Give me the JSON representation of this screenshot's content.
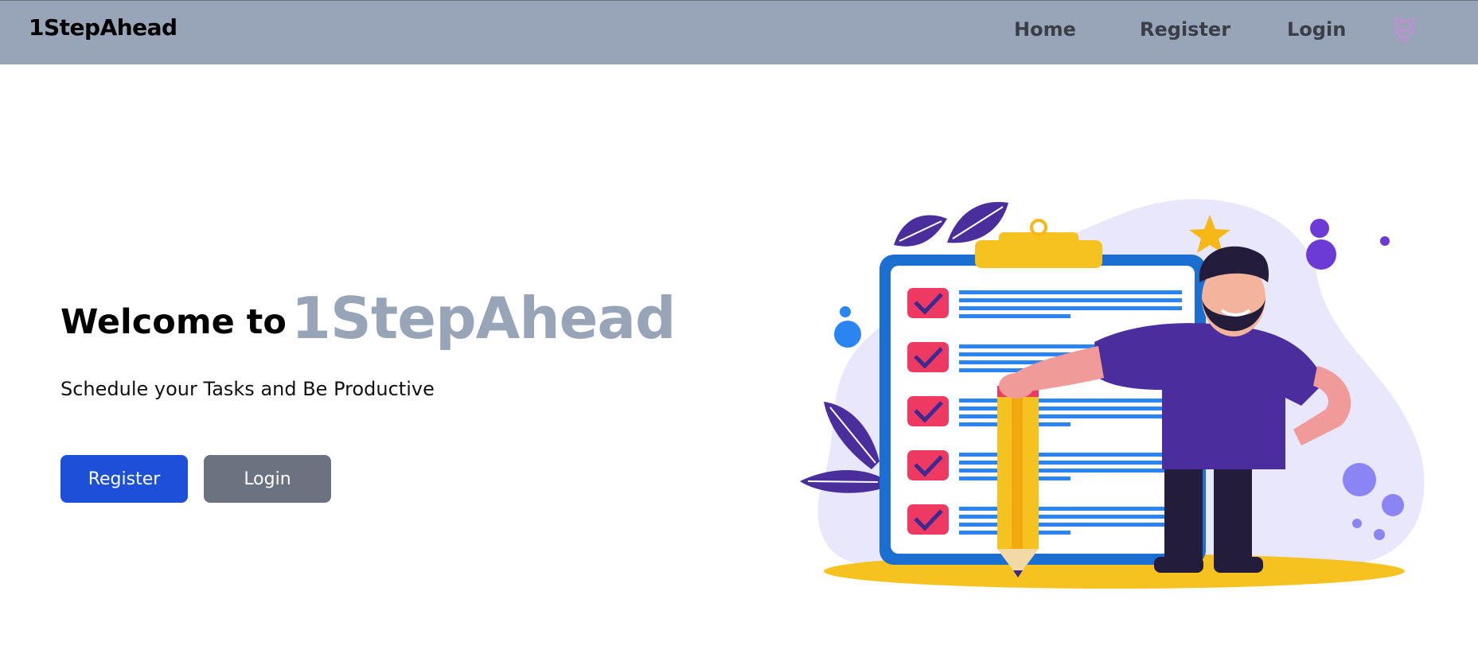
{
  "navbar": {
    "brand": "1StepAhead",
    "links": [
      {
        "label": "Home"
      },
      {
        "label": "Register"
      },
      {
        "label": "Login"
      }
    ],
    "icon": "flow-connector-icon"
  },
  "hero": {
    "title_prefix": "Welcome to",
    "title_brand": "1StepAhead",
    "subtitle": "Schedule your Tasks and Be Productive",
    "register_label": "Register",
    "login_label": "Login"
  },
  "colors": {
    "navbar_bg": "#98a5b9",
    "brand_accent": "#98a5b9",
    "primary_button": "#1e4fd8",
    "secondary_button": "#6b7280"
  },
  "illustration": {
    "subject": "man-with-pencil-and-checklist-illustration"
  }
}
